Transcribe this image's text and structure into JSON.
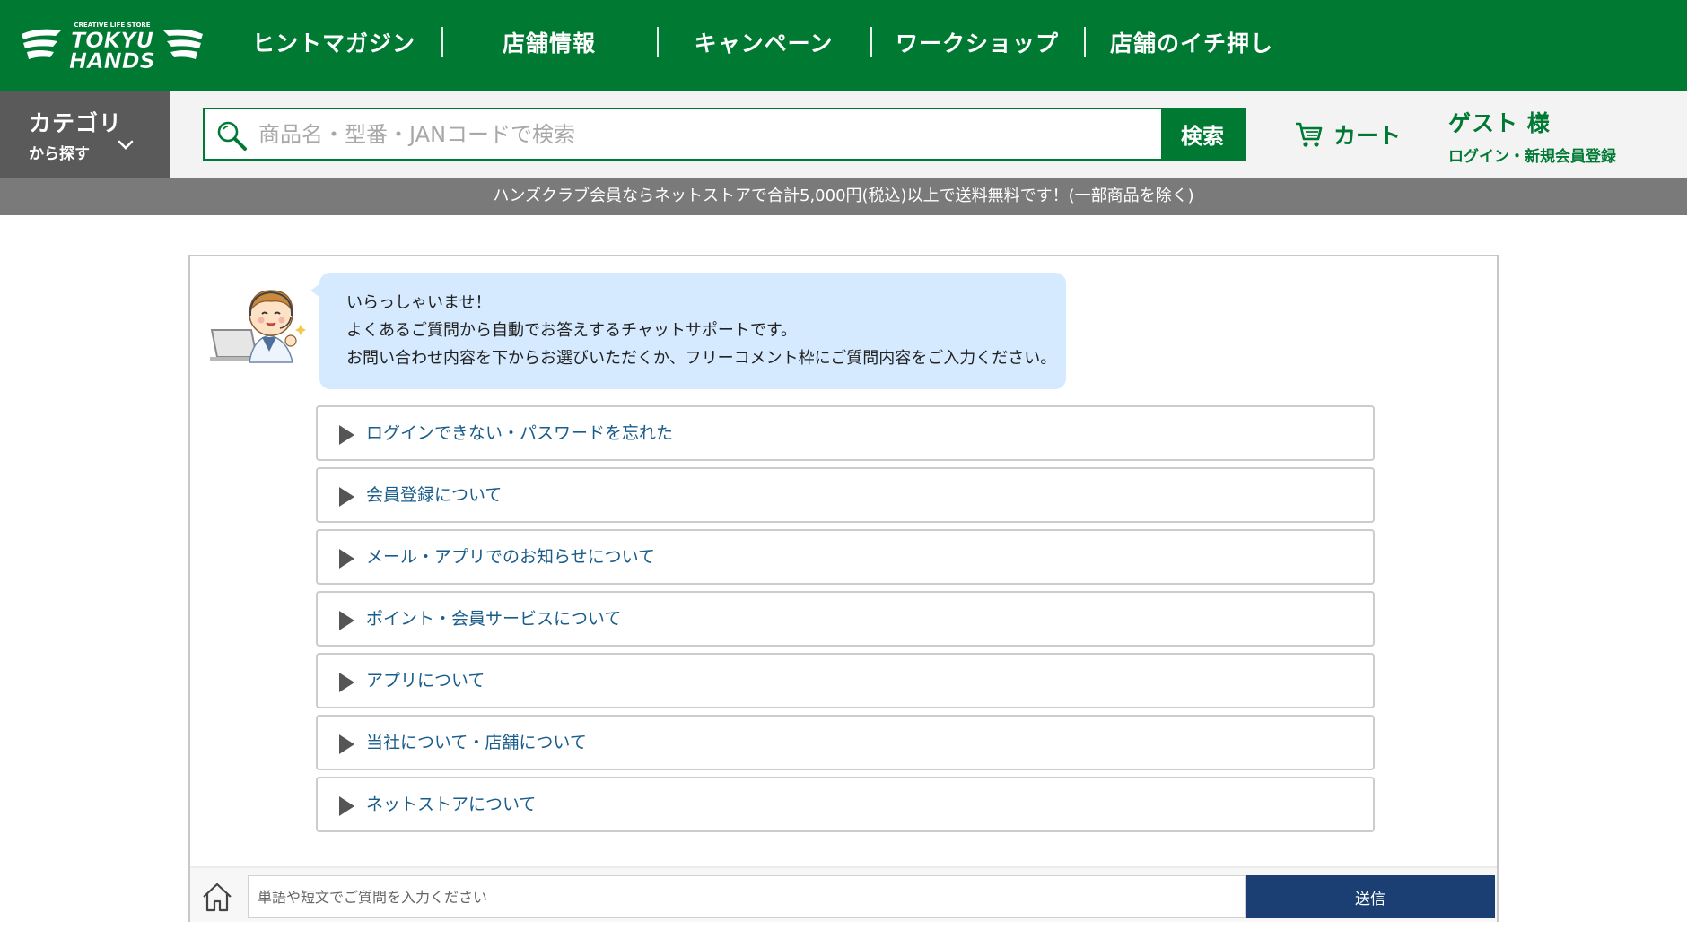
{
  "brand": {
    "logo_text_small": "CREATIVE LIFE STORE",
    "logo_text_line1": "TOKYU",
    "logo_text_line2": "HANDS"
  },
  "nav": {
    "items": [
      {
        "label": "ヒントマガジン"
      },
      {
        "label": "店舗情報"
      },
      {
        "label": "キャンペーン"
      },
      {
        "label": "ワークショップ"
      },
      {
        "label": "店舗のイチ押し"
      }
    ]
  },
  "category": {
    "title": "カテゴリ",
    "subtitle": "から探す",
    "icon": "chevron-down-icon"
  },
  "search": {
    "placeholder": "商品名・型番・JANコードで検索",
    "value": "",
    "button_label": "検索",
    "icon": "search-icon"
  },
  "cart": {
    "label": "カート",
    "icon": "cart-icon"
  },
  "account": {
    "name": "ゲスト 様",
    "link": "ログイン・新規会員登録"
  },
  "notice": {
    "text": "ハンズクラブ会員ならネットストアで合計5,000円(税込)以上で送料無料です！(一部商品を除く)"
  },
  "chat": {
    "bubble_lines": [
      "いらっしゃいませ！",
      "よくあるご質問から自動でお答えするチャットサポートです。",
      "お問い合わせ内容を下からお選びいただくか、フリーコメント枠にご質問内容をご入力ください。"
    ],
    "faq": [
      {
        "label": "ログインできない・パスワードを忘れた"
      },
      {
        "label": "会員登録について"
      },
      {
        "label": "メール・アプリでのお知らせについて"
      },
      {
        "label": "ポイント・会員サービスについて"
      },
      {
        "label": "アプリについて"
      },
      {
        "label": "当社について・店舗について"
      },
      {
        "label": "ネットストアについて"
      }
    ],
    "input_placeholder": "単語や短文でご質問を入力ください",
    "input_value": "",
    "send_label": "送信"
  },
  "colors": {
    "brand_green": "#007a33",
    "category_gray": "#5a5a5a",
    "notice_gray": "#7a7a7a",
    "bubble_blue": "#d5eaff",
    "faq_text_blue": "#1a5d8a",
    "send_navy": "#1b3f73"
  }
}
